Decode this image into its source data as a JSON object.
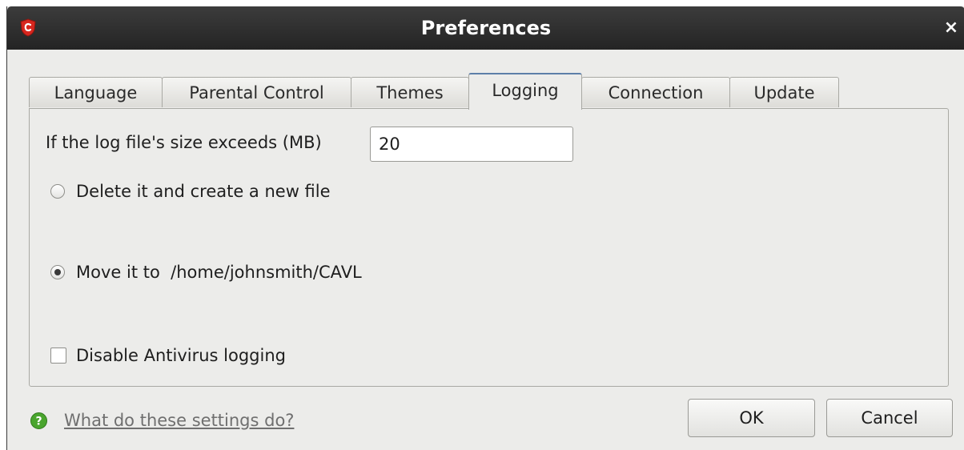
{
  "window": {
    "title": "Preferences",
    "close_glyph": "×",
    "icon": "comodo-shield-icon"
  },
  "tabs": [
    {
      "label": "Language",
      "active": false
    },
    {
      "label": "Parental Control",
      "active": false
    },
    {
      "label": "Themes",
      "active": false
    },
    {
      "label": "Logging",
      "active": true
    },
    {
      "label": "Connection",
      "active": false
    },
    {
      "label": "Update",
      "active": false
    }
  ],
  "logging": {
    "size_label": "If the log file's size exceeds (MB)",
    "size_value": "20",
    "option_delete_label": "Delete it and create a new file",
    "option_delete_selected": false,
    "option_move_label": "Move it to  /home/johnsmith/CAVL",
    "option_move_selected": true,
    "disable_logging_label": "Disable Antivirus logging",
    "disable_logging_checked": false
  },
  "footer": {
    "help_icon": "question-mark-icon",
    "help_link": "What do these settings do?",
    "ok_label": "OK",
    "cancel_label": "Cancel"
  },
  "colors": {
    "titlebar": "#2e2e2e",
    "window_bg": "#ececea",
    "active_tab_accent": "#5d7fa8",
    "brand_red": "#d7261e",
    "help_green": "#4aa52e"
  }
}
